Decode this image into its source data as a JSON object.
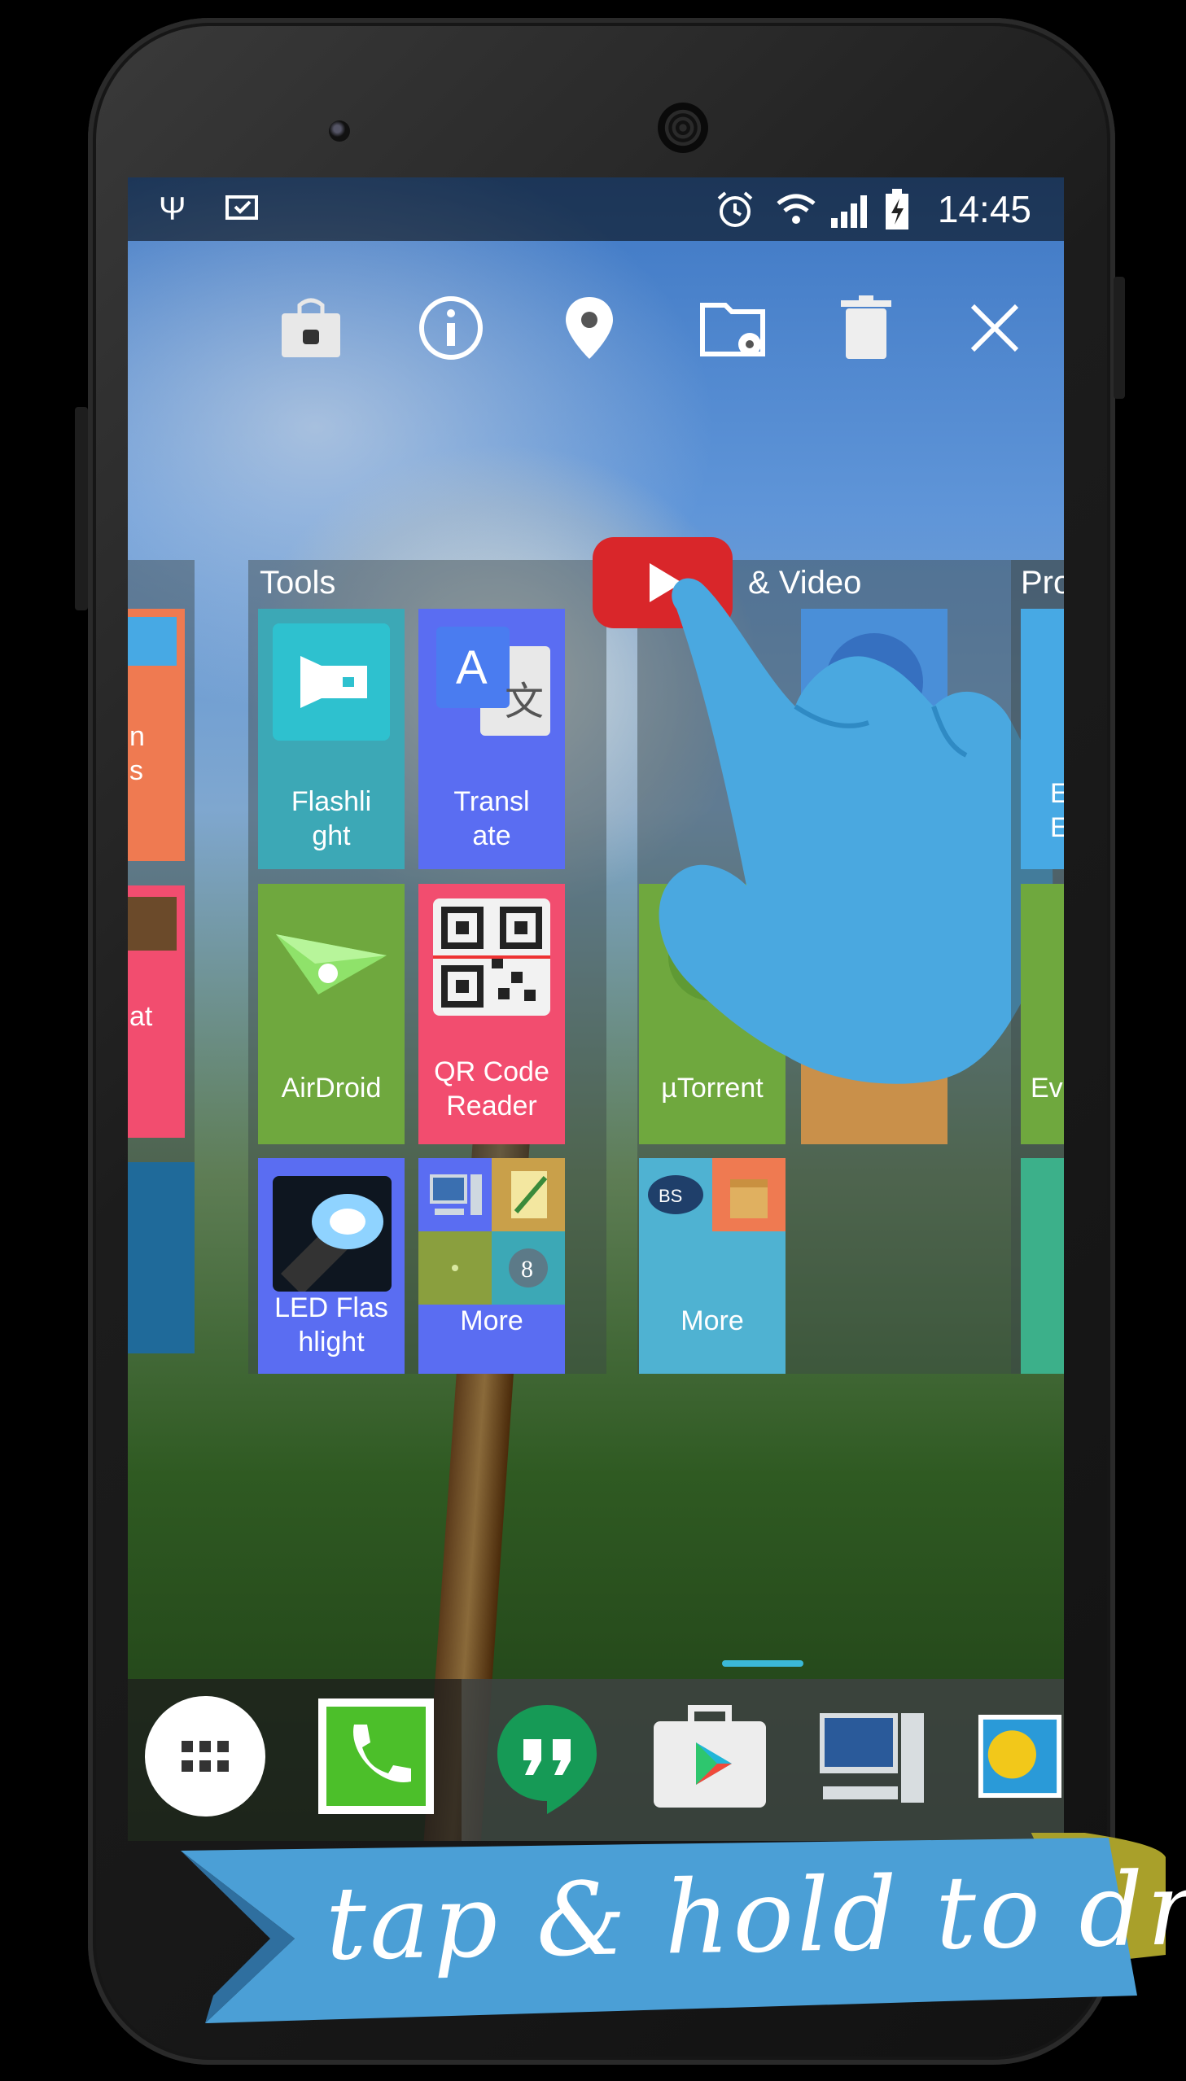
{
  "status_bar": {
    "time": "14:45"
  },
  "toolbar": {
    "icons": [
      "store-icon",
      "info-icon",
      "location-pin-icon",
      "folder-settings-icon",
      "trash-icon",
      "close-icon"
    ]
  },
  "groups": {
    "tools": {
      "title": "Tools"
    },
    "video": {
      "title": "& Video"
    },
    "productivity": {
      "title": "Pro"
    }
  },
  "tiles": {
    "flashlight": "Flashli\nght",
    "translate": "Transl\nate",
    "airdroid": "AirDroid",
    "qr_reader": "QR Code\nReader",
    "led_flashlight": "LED Flas\nhlight",
    "more_tools": "More",
    "utorrent": "µTorrent",
    "more_video": "More",
    "partial_left_1": "n\ns",
    "partial_left_2": "at",
    "partial_right_1": "E\nEx",
    "partial_right_2": "Ev"
  },
  "banner": {
    "text": "tap & hold to drag"
  },
  "colors": {
    "teal": "#3ca8b6",
    "blue_violet": "#5a6df2",
    "green": "#6fa83e",
    "pink": "#f24d6f",
    "orange": "#ef7a51",
    "sky": "#47a9e4",
    "youtube_red": "#d9262a"
  }
}
